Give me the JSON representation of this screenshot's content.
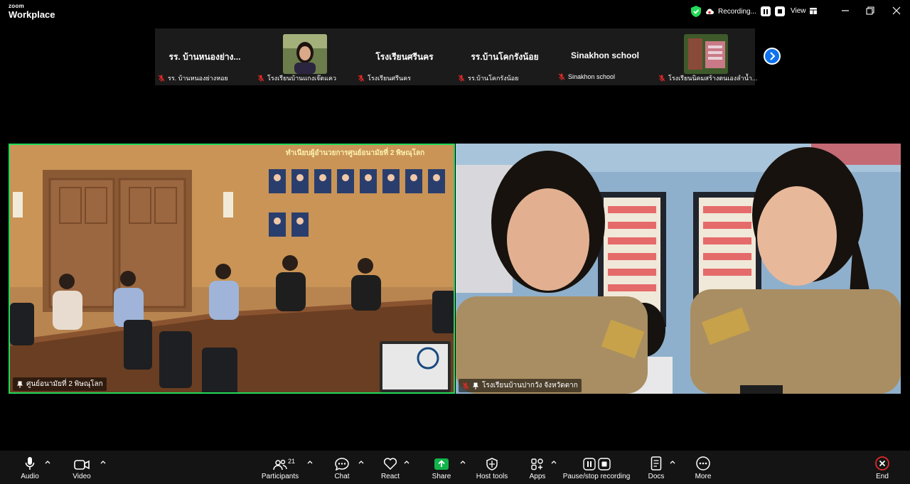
{
  "app": {
    "logo_top": "zoom",
    "logo_bottom": "Workplace"
  },
  "titlebar": {
    "recording_label": "Recording...",
    "view_label": "View"
  },
  "colors": {
    "accent_blue": "#0e72ed",
    "active_speaker": "#23d959",
    "share_green": "#12b34b",
    "end_red": "#e02828"
  },
  "gallery": {
    "tiles": [
      {
        "name": "รร. บ้านหนองย่าง...",
        "caption": "รร. บ้านหนองย่างหอย",
        "has_video": false
      },
      {
        "name": "",
        "caption": "โรงเรียนบ้านแกงเจ๊ตแคว",
        "has_video": true
      },
      {
        "name": "โรงเรียนศรีนคร",
        "caption": "โรงเรียนศรีนคร",
        "has_video": false
      },
      {
        "name": "รร.บ้านโคกรังน้อย",
        "caption": "รร.บ้านโคกรังน้อย",
        "has_video": false
      },
      {
        "name": "Sinakhon school",
        "caption": "Sinakhon school",
        "has_video": false
      },
      {
        "name": "",
        "caption": "โรงเรียนนิคมสร้างตนเองลำน้ำ...",
        "has_video": true
      }
    ],
    "next_icon": "chevron-right-icon"
  },
  "videos": {
    "left": {
      "label": "ศูนย์อนามัยที่ 2 พิษณุโลก",
      "sign_text": "ทำเนียบผู้อำนวยการศูนย์อนามัยที่ 2 พิษณุโลก",
      "icon": "pin-icon"
    },
    "right": {
      "label": "โรงเรียนบ้านปากวัง จังหวัดตาก",
      "icon": "mic-muted-icon"
    }
  },
  "toolbar": {
    "audio": "Audio",
    "video": "Video",
    "participants": "Participants",
    "participants_count": "21",
    "chat": "Chat",
    "react": "React",
    "share": "Share",
    "host_tools": "Host tools",
    "apps": "Apps",
    "pause_stop": "Pause/stop recording",
    "docs": "Docs",
    "more": "More",
    "end": "End"
  }
}
